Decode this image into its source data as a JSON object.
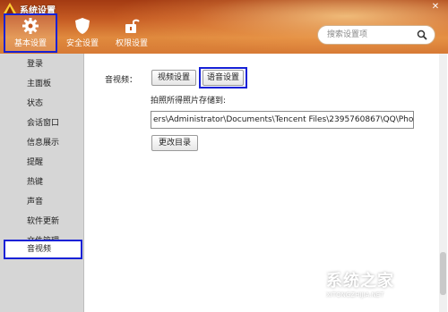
{
  "window": {
    "title": "系统设置",
    "close_glyph": "✕"
  },
  "toolbar": {
    "items": [
      {
        "label": "基本设置",
        "icon": "gear-icon"
      },
      {
        "label": "安全设置",
        "icon": "shield-icon"
      },
      {
        "label": "权限设置",
        "icon": "unlock-icon"
      }
    ]
  },
  "search": {
    "placeholder": "搜索设置项",
    "icon": "search-icon"
  },
  "sidebar": {
    "items": [
      {
        "label": "登录"
      },
      {
        "label": "主面板"
      },
      {
        "label": "状态"
      },
      {
        "label": "会话窗口"
      },
      {
        "label": "信息展示"
      },
      {
        "label": "提醒"
      },
      {
        "label": "热键"
      },
      {
        "label": "声音"
      },
      {
        "label": "软件更新"
      },
      {
        "label": "文件管理"
      },
      {
        "label": "音视频"
      }
    ],
    "active": "音视频"
  },
  "content": {
    "section_label": "音视频：",
    "video_button": "视频设置",
    "voice_button": "语音设置",
    "photo_label": "拍照所得照片存储到:",
    "photo_path": "ers\\Administrator\\Documents\\Tencent Files\\2395760867\\QQ\\Photo\\",
    "change_dir_button": "更改目录"
  },
  "watermark": {
    "text": "系统之家",
    "url": "XITONGZHIJIA.NET"
  },
  "colors": {
    "header": "#c55a22",
    "highlight": "#1621d6",
    "sidebar_bg": "#d6d6d6"
  }
}
